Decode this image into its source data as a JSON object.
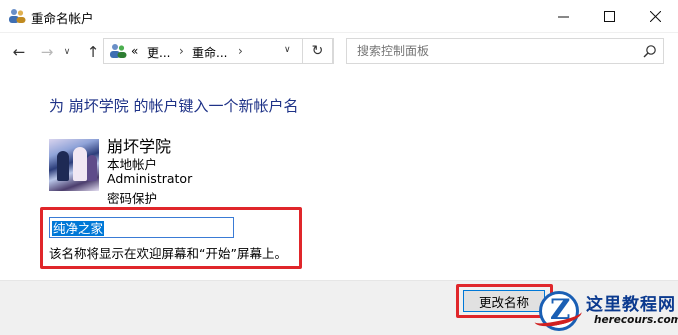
{
  "window": {
    "title": "重命名帐户",
    "icon": "users-icon",
    "controls": [
      "minimize-icon",
      "maximize-icon",
      "close-icon"
    ]
  },
  "nav": {
    "back_glyph": "←",
    "forward_glyph": "→",
    "history_glyph": "∨",
    "up_glyph": "↑",
    "breadcrumb": {
      "overflow": "«",
      "items": [
        "更...",
        "重命..."
      ],
      "separator": "›",
      "dropdown_glyph": "∨"
    },
    "refresh_glyph": "↻",
    "search_placeholder": "搜索控制面板"
  },
  "main": {
    "heading": "为 崩坏学院 的帐户键入一个新帐户名",
    "account": {
      "name": "崩坏学院",
      "type": "本地帐户",
      "group": "Administrator",
      "protection": "密码保护"
    },
    "new_name_value": "纯净之家",
    "hint": "该名称将显示在欢迎屏幕和“开始”屏幕上。"
  },
  "footer": {
    "rename_button": "更改名称"
  },
  "watermark": {
    "logo_letter": "Z",
    "title": "这里教程网",
    "url": "herecours.com"
  },
  "colors": {
    "heading": "#1e3287",
    "highlight_box": "#e0262a",
    "selection": "#0078d7"
  }
}
